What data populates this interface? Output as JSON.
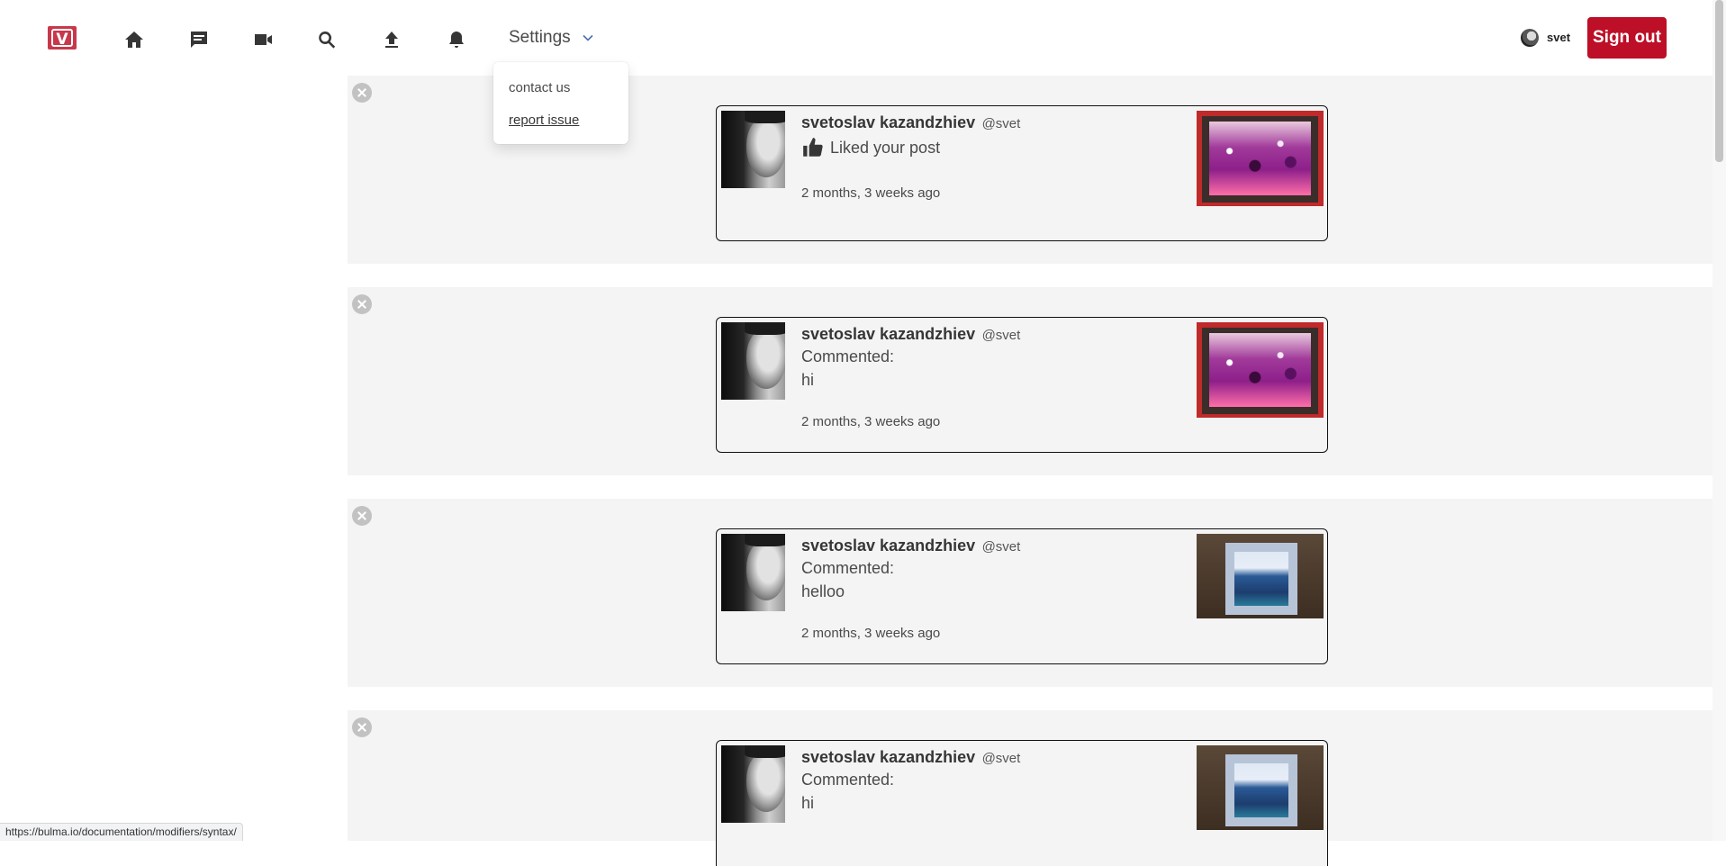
{
  "nav": {
    "logo_letter": "V",
    "icons": [
      "home-icon",
      "messages-icon",
      "video-icon",
      "search-icon",
      "upload-icon",
      "bell-icon"
    ],
    "settings_label": "Settings",
    "dropdown": {
      "contact": "contact us",
      "report": "report issue"
    },
    "username": "svet",
    "signout_label": "Sign out",
    "accent_color": "#bd0f27"
  },
  "notifications": [
    {
      "name": "svetoslav kazandzhiev",
      "handle": "@svet",
      "action": "Liked your post",
      "comment": "",
      "time": "2 months, 3 weeks ago",
      "thumbnail": "red-flower-painting"
    },
    {
      "name": "svetoslav kazandzhiev",
      "handle": "@svet",
      "action": "Commented:",
      "comment": "hi",
      "time": "2 months, 3 weeks ago",
      "thumbnail": "red-flower-painting"
    },
    {
      "name": "svetoslav kazandzhiev",
      "handle": "@svet",
      "action": "Commented:",
      "comment": "helloo",
      "time": "2 months, 3 weeks ago",
      "thumbnail": "blue-abstract-painting"
    },
    {
      "name": "svetoslav kazandzhiev",
      "handle": "@svet",
      "action": "Commented:",
      "comment": "hi",
      "time": "",
      "thumbnail": "blue-abstract-painting"
    }
  ],
  "status_url": "https://bulma.io/documentation/modifiers/syntax/"
}
